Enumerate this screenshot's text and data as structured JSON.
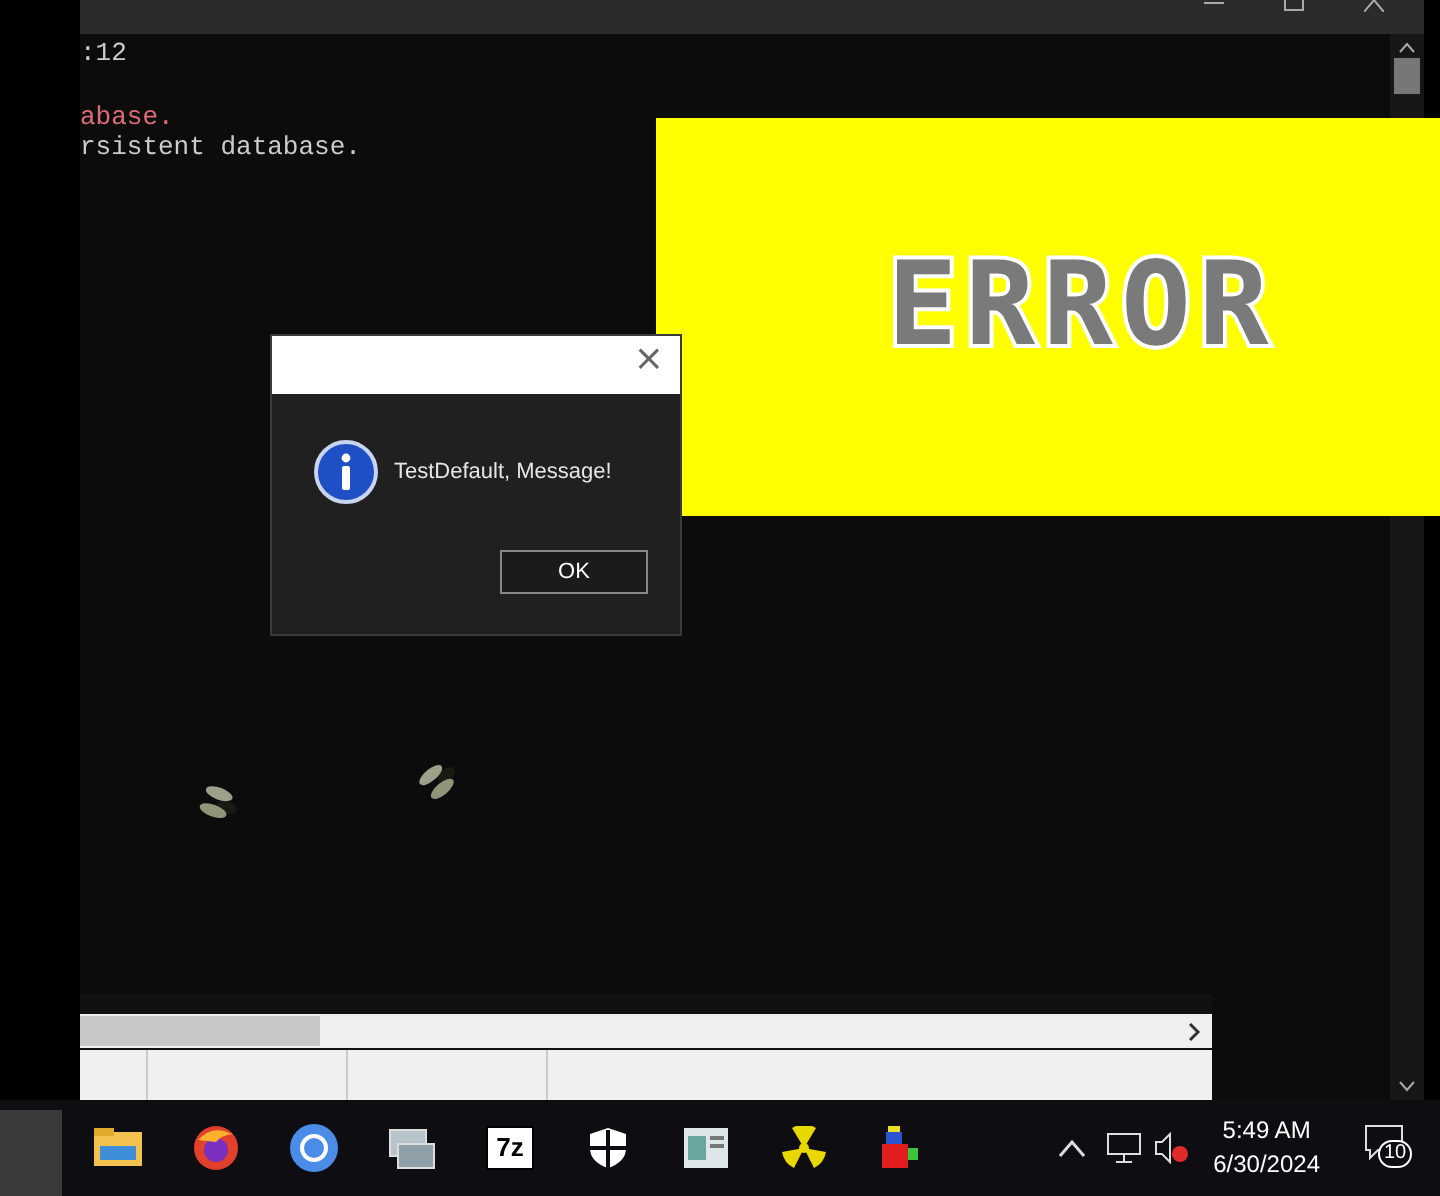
{
  "console": {
    "header_line": ":12",
    "lines": [
      {
        "text": "abase.",
        "kind": "error"
      },
      {
        "text": "rsistent database.",
        "kind": "normal"
      }
    ]
  },
  "overlay": {
    "banner": "ERROR"
  },
  "dialog": {
    "close": "×",
    "message": "TestDefault, Message!",
    "button": "OK"
  },
  "taskbar": {
    "archive_label": "7z",
    "time": "5:49 AM",
    "date": "6/30/2024",
    "notifications": "10"
  }
}
